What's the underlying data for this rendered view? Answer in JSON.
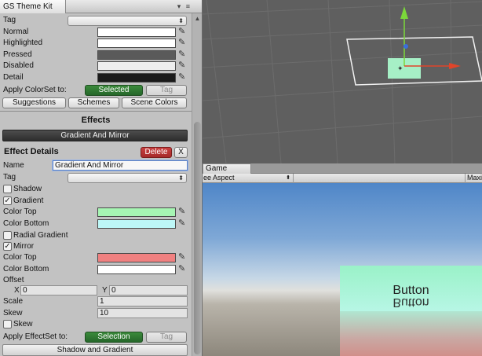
{
  "window": {
    "tab_title": "GS Theme Kit",
    "controls": "▾ ≡"
  },
  "colorset": {
    "tag_label": "Tag",
    "rows": [
      {
        "label": "Normal",
        "color": "#ffffff"
      },
      {
        "label": "Highlighted",
        "color": "#ffffff"
      },
      {
        "label": "Pressed",
        "color": "#5a5a5a"
      },
      {
        "label": "Disabled",
        "color": "#eeeeee"
      },
      {
        "label": "Detail",
        "color": "#1a1a1a"
      }
    ],
    "apply_label": "Apply ColorSet to:",
    "selected_btn": "Selected",
    "tag_btn": "Tag",
    "suggestions_btn": "Suggestions",
    "schemes_btn": "Schemes",
    "scene_colors_btn": "Scene Colors"
  },
  "effects": {
    "section_title": "Effects",
    "current_effect": "Gradient And Mirror",
    "details_title": "Effect Details",
    "delete_btn": "Delete",
    "close_btn": "X",
    "name_label": "Name",
    "name_value": "Gradient And Mirror",
    "tag_label": "Tag",
    "shadow_label": "Shadow",
    "shadow_checked": false,
    "gradient_label": "Gradient",
    "gradient_checked": true,
    "color_top_label": "Color Top",
    "gradient_color_top": "#a6f5b3",
    "color_bottom_label": "Color Bottom",
    "gradient_color_bottom": "#bdf7f7",
    "radial_label": "Radial Gradient",
    "radial_checked": false,
    "mirror_label": "Mirror",
    "mirror_checked": true,
    "mirror_color_top": "#f08080",
    "mirror_color_bottom": "#ffffff",
    "offset_label": "Offset",
    "offset_x_label": "X",
    "offset_x": "0",
    "offset_y_label": "Y",
    "offset_y": "0",
    "scale_label": "Scale",
    "scale_value": "1",
    "skew_label": "Skew",
    "skew_value": "10",
    "skew_check_label": "Skew",
    "skew_checked": false,
    "apply_label": "Apply EffectSet to:",
    "selection_btn": "Selection",
    "tag_btn": "Tag",
    "next_effect": "Shadow and Gradient"
  },
  "checkmark": "✓",
  "dropdown_arrow": "⬍",
  "game": {
    "tab_label": "Game",
    "aspect_label": "ee Aspect",
    "maximize_label": "Maxi",
    "button_text": "Button"
  },
  "icons": {
    "picker": "eyedropper-icon",
    "check": "checkmark-icon"
  },
  "colors": {
    "accent_green": "#2f7a32",
    "delete_red": "#b83434"
  }
}
